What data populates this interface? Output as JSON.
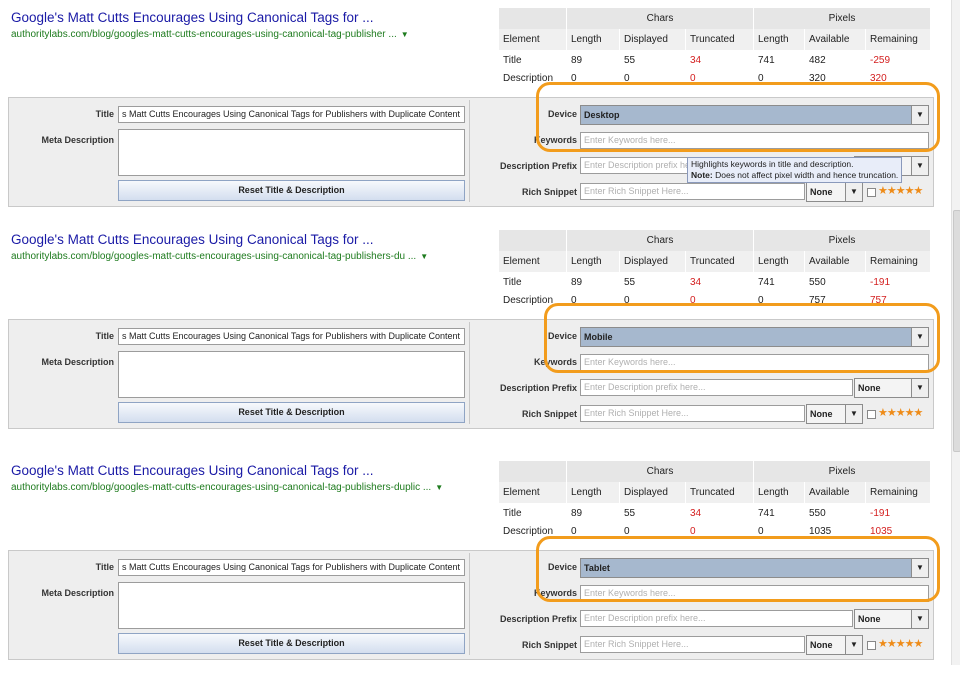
{
  "panels": [
    {
      "serp_title": "Google's Matt Cutts Encourages Using Canonical Tags for ...",
      "serp_url": "authoritylabs.com/blog/googles-matt-cutts-encourages-using-canonical-tag-publisher ...",
      "title_length": "89",
      "title_displayed": "55",
      "title_truncated": "34",
      "title_px_length": "741",
      "title_px_available": "482",
      "title_px_remaining": "-259",
      "desc_partial": [
        "0",
        "0",
        "0",
        "0",
        "320",
        "320"
      ],
      "device": "Desktop",
      "title_value": "s Matt Cutts Encourages Using Canonical Tags for Publishers with Duplicate Content",
      "prefix_select": ""
    },
    {
      "serp_title": "Google's Matt Cutts Encourages Using Canonical Tags for ...",
      "serp_url": "authoritylabs.com/blog/googles-matt-cutts-encourages-using-canonical-tag-publishers-du ...",
      "title_length": "89",
      "title_displayed": "55",
      "title_truncated": "34",
      "title_px_length": "741",
      "title_px_available": "550",
      "title_px_remaining": "-191",
      "desc_partial": [
        "0",
        "0",
        "0",
        "0",
        "757",
        "757"
      ],
      "device": "Mobile",
      "title_value": "s Matt Cutts Encourages Using Canonical Tags for Publishers with Duplicate Content",
      "prefix_select": "None"
    },
    {
      "serp_title": "Google's Matt Cutts Encourages Using Canonical Tags for ...",
      "serp_url": "authoritylabs.com/blog/googles-matt-cutts-encourages-using-canonical-tag-publishers-duplic ...",
      "title_length": "89",
      "title_displayed": "55",
      "title_truncated": "34",
      "title_px_length": "741",
      "title_px_available": "550",
      "title_px_remaining": "-191",
      "desc_partial": [
        "0",
        "0",
        "0",
        "0",
        "1035",
        "1035"
      ],
      "device": "Tablet",
      "title_value": "s Matt Cutts Encourages Using Canonical Tags for Publishers with Duplicate Content",
      "prefix_select": "None"
    }
  ],
  "table": {
    "chars_header": "Chars",
    "pixels_header": "Pixels",
    "col_element": "Element",
    "col_length": "Length",
    "col_displayed": "Displayed",
    "col_truncated": "Truncated",
    "col_px_length": "Length",
    "col_available": "Available",
    "col_remaining": "Remaining",
    "row_title": "Title",
    "row_description": "Description"
  },
  "form": {
    "title_label": "Title",
    "meta_label": "Meta Description",
    "reset_button": "Reset Title & Description",
    "device_label": "Device",
    "keywords_label": "Keywords",
    "keywords_placeholder": "Enter Keywords here...",
    "prefix_label": "Description Prefix",
    "prefix_placeholder": "Enter Description prefix here...",
    "rich_label": "Rich Snippet",
    "rich_placeholder": "Enter Rich Snippet Here...",
    "rich_select": "None",
    "stars": "★★★★★"
  },
  "tooltip": {
    "line1": "Highlights keywords in title and description.",
    "note_label": "Note:",
    "line2": " Does not affect pixel width and hence truncation."
  },
  "colors": {
    "highlight": "#f29c1c",
    "serp_title": "#1a1aa6",
    "serp_url": "#1e7b1e",
    "negative": "#d42020",
    "stars": "#ee8b18",
    "device_select": "#a6b8ce"
  }
}
